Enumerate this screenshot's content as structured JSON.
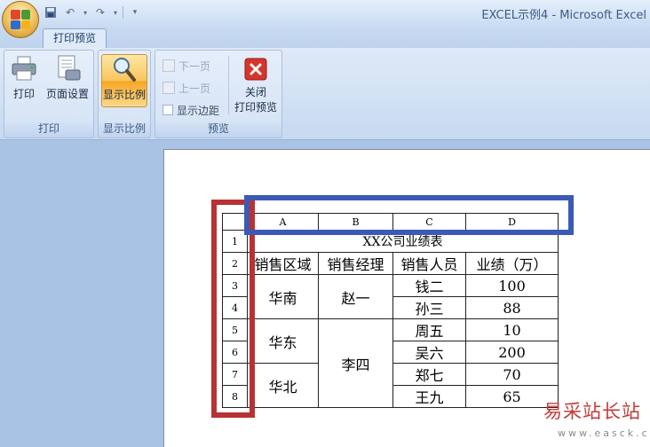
{
  "window": {
    "title": "EXCEL示例4 - Microsoft Excel"
  },
  "ribbon": {
    "active_tab": "打印预览",
    "groups": {
      "print": {
        "label": "打印",
        "print_btn": "打印",
        "page_setup_btn": "页面设置"
      },
      "zoom": {
        "label": "显示比例",
        "zoom_btn": "显示比例"
      },
      "preview": {
        "label": "预览",
        "next_page": "下一页",
        "prev_page": "上一页",
        "show_margins": "显示边距",
        "close_line1": "关闭",
        "close_line2": "打印预览"
      }
    }
  },
  "sheet": {
    "col_headers": [
      "A",
      "B",
      "C",
      "D"
    ],
    "row_headers": [
      "1",
      "2",
      "3",
      "4",
      "5",
      "6",
      "7",
      "8"
    ],
    "title": "XX公司业绩表",
    "header_row": [
      "销售区域",
      "销售经理",
      "销售人员",
      "业绩（万）"
    ],
    "regions": [
      "华南",
      "华东",
      "华北"
    ],
    "managers": [
      "赵一",
      "李四"
    ],
    "sales_people": [
      "钱二",
      "孙三",
      "周五",
      "吴六",
      "郑七",
      "王九"
    ],
    "amounts": [
      "100",
      "88",
      "10",
      "200",
      "70",
      "65"
    ]
  },
  "watermark": {
    "line1": "易采站长站",
    "line2": "www.easck.com"
  }
}
